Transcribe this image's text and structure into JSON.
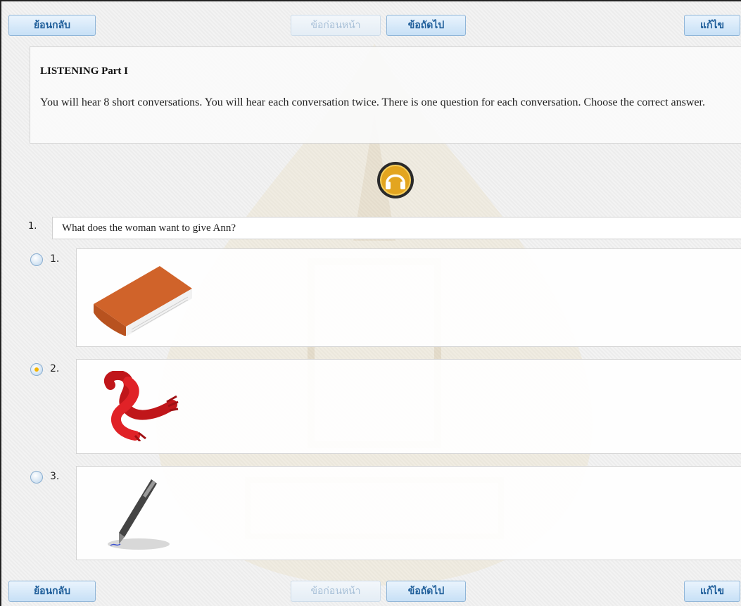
{
  "nav": {
    "back_label": "ย้อนกลับ",
    "prev_label": "ข้อก่อนหน้า",
    "next_label": "ข้อถัดไป",
    "edit_label": "แก้ไข"
  },
  "instructions": {
    "title": "LISTENING Part I",
    "text": "You will hear 8 short conversations.  You will hear each conversation twice.  There is one question for each conversation. Choose the correct answer."
  },
  "audio": {
    "icon": "headphones-icon"
  },
  "question": {
    "number": "1.",
    "text": "What does the woman want to give Ann?"
  },
  "options": [
    {
      "label": "1.",
      "image": "book-icon",
      "selected": false
    },
    {
      "label": "2.",
      "image": "scarf-icon",
      "selected": true
    },
    {
      "label": "3.",
      "image": "pen-icon",
      "selected": false
    }
  ],
  "colors": {
    "accent": "#1f5e9a",
    "selected_radio": "#f4b400",
    "audio_button": "#e3a520"
  }
}
